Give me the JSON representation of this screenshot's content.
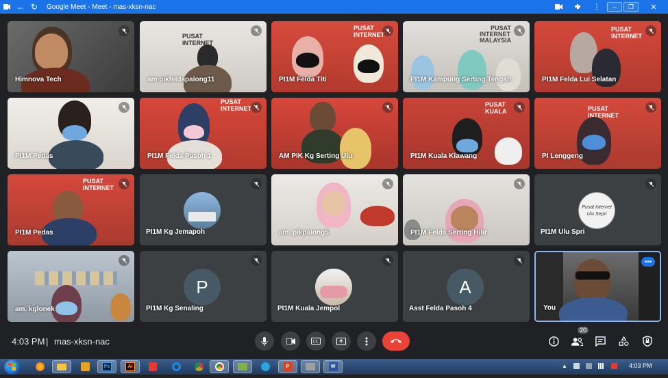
{
  "window": {
    "title": "Google Meet - Meet - mas-xksn-nac"
  },
  "tiles": [
    {
      "name": "Himnova Tech"
    },
    {
      "name": "am pikfeldapalong11"
    },
    {
      "name": "PI1M Felda Titi"
    },
    {
      "name": "PI1M Kampung Serting Tengah"
    },
    {
      "name": "PI1M Felda Lui Selatan"
    },
    {
      "name": "PI1M Pedas"
    },
    {
      "name": "PI1M Felda Pasoh 1"
    },
    {
      "name": "AM PIK Kg Serting Ulu"
    },
    {
      "name": "PI1M Kuala Klawang"
    },
    {
      "name": "PI Lenggeng"
    },
    {
      "name": "PI1M Pedas"
    },
    {
      "name": "PI1M Kg Jemapoh"
    },
    {
      "name": "am. pikpalong5"
    },
    {
      "name": "PI1M Felda Serting Hilir"
    },
    {
      "name": "PI1M Ulu Spri"
    },
    {
      "name": "am. kglonek"
    },
    {
      "name": "PI1M Kg Senaling",
      "initial": "P"
    },
    {
      "name": "PI1M Kuala Jempol"
    },
    {
      "name": "Asst Felda Pasoh 4",
      "initial": "A"
    },
    {
      "name": "You"
    }
  ],
  "signs": {
    "pusat": "PUSAT",
    "internet": "INTERNET",
    "malaysia": "MALAYSIA",
    "kuala": "KUALA",
    "ulu_logo_line1": "Pusat Internet",
    "ulu_logo_line2": "Ulu Sepri"
  },
  "bottom_bar": {
    "time": "4:03 PM",
    "separator": "|",
    "meeting_code": "mas-xksn-nac",
    "participant_count": "20"
  },
  "taskbar": {
    "clock": "4:03 PM",
    "apps": [
      "firefox",
      "explorer",
      "media",
      "Ps",
      "Ai",
      "security",
      "ie",
      "chrome-alt",
      "chrome",
      "map",
      "telegram",
      "P",
      "tool",
      "W"
    ]
  },
  "colors": {
    "accent": "#1a73e8",
    "end_call": "#ea4335",
    "background": "#202124"
  }
}
